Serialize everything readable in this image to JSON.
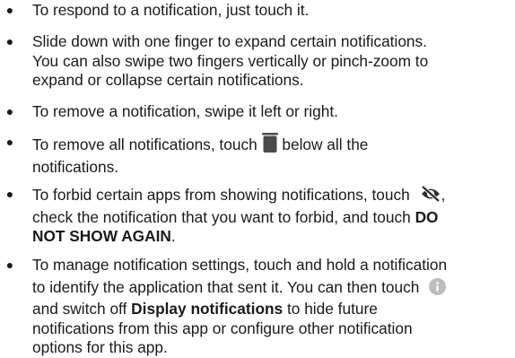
{
  "items": [
    {
      "lines": [
        "To respond to a notification, just touch it."
      ]
    },
    {
      "lines": [
        "Slide down with one finger to expand certain notifications.",
        "You can also swipe two fingers vertically or pinch-zoom to",
        "expand or collapse certain notifications."
      ]
    },
    {
      "lines": [
        "To remove a notification, swipe it left or right."
      ]
    },
    {
      "line1_before": "To remove all notifications, touch",
      "line1_after": "below all the",
      "line2": "notifications.",
      "icon": "trash-icon"
    },
    {
      "line1": "To forbid certain apps from showing notifications, touch",
      "line1_tail": ",",
      "line2_before": "check the notification that you want to forbid, and touch",
      "line2_bold": "DO",
      "line3_bold": "NOT SHOW AGAIN",
      "line3_tail": ".",
      "icon": "eye-off-icon"
    },
    {
      "line1": "To manage notification settings, touch and hold a notification",
      "line2": "to identify the application that sent it. You can then touch",
      "line3_bold": "Display notifications",
      "line3_before": "and switch off",
      "line3_after": "to hide future",
      "line4": "notifications from this app or configure other notification",
      "line5": "options for this app.",
      "icon": "info-icon"
    }
  ],
  "colors": {
    "text": "#1a1a1a",
    "icon": "#4a4a4a",
    "info_icon_bg": "#bdbdbd"
  }
}
